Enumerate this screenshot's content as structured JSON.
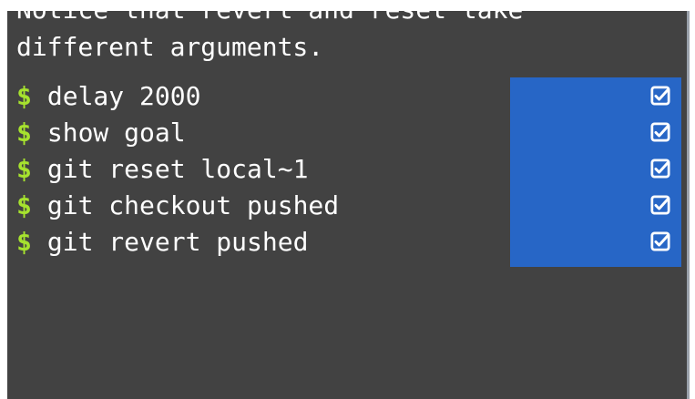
{
  "terminal": {
    "partial_line": "Notice that revert and reset take",
    "wrap_line": "different arguments.",
    "prompt_symbol": "$",
    "commands": [
      {
        "text": "delay 2000"
      },
      {
        "text": "show goal"
      },
      {
        "text": "git reset local~1"
      },
      {
        "text": "git checkout pushed"
      },
      {
        "text": "git revert pushed"
      }
    ],
    "status_icon": "checkbox-checked-icon",
    "colors": {
      "background": "#424242",
      "prompt": "#a6e22e",
      "status_panel": "#2766c6",
      "text": "#ffffff"
    }
  }
}
